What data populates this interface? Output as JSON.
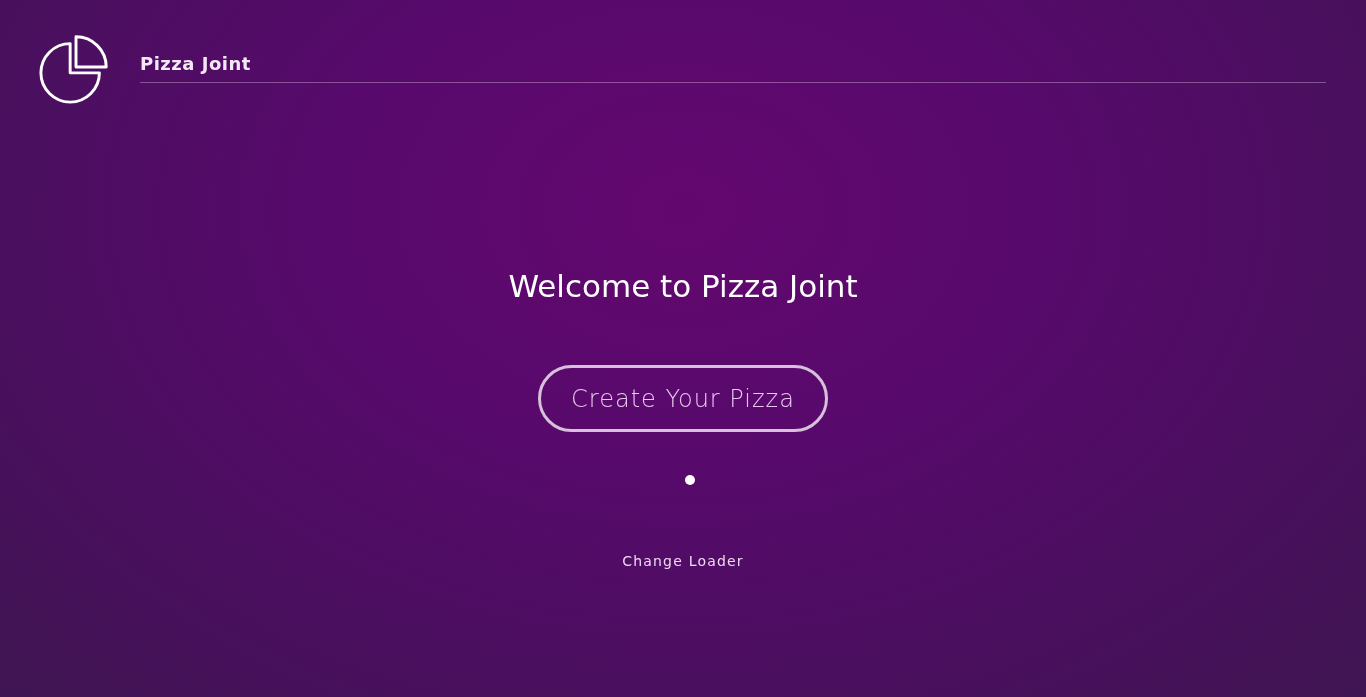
{
  "header": {
    "title": "Pizza Joint"
  },
  "welcome": {
    "heading": "Welcome to Pizza Joint",
    "button": "Create Your Pizza"
  },
  "loader_link": "Change Loader"
}
